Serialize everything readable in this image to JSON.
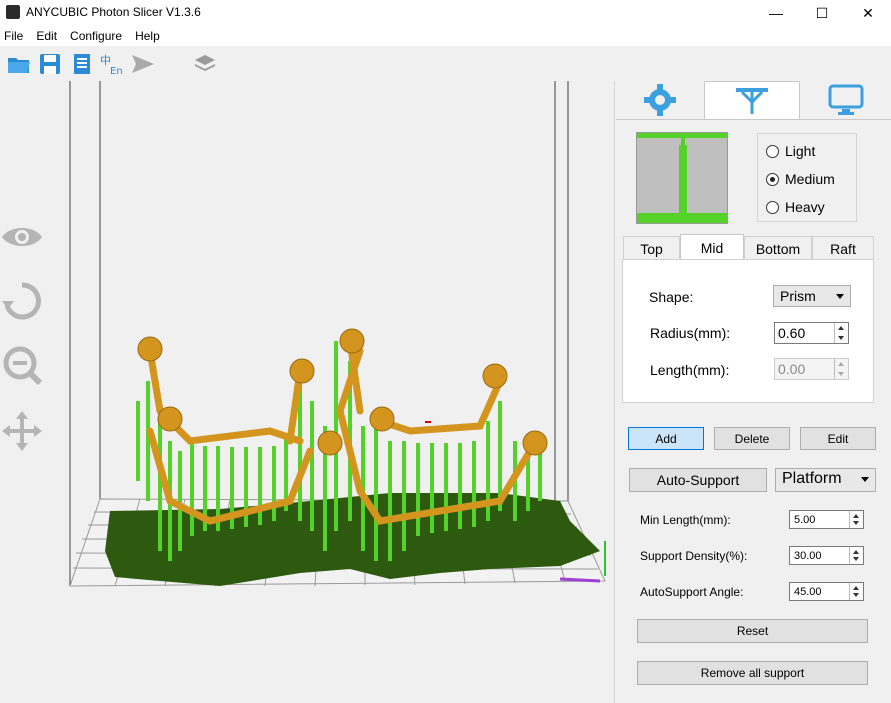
{
  "window": {
    "title": "ANYCUBIC Photon Slicer V1.3.6",
    "controls": {
      "minimize": "—",
      "maximize": "☐",
      "close": "✕"
    }
  },
  "menu": {
    "items": [
      "File",
      "Edit",
      "Configure",
      "Help"
    ]
  },
  "toolbar": {
    "icons": [
      "open-folder-icon",
      "save-icon",
      "document-icon",
      "language-icon",
      "send-icon",
      "layers-icon"
    ]
  },
  "viewport": {
    "side_icons": [
      "eye-icon",
      "rotate-icon",
      "zoom-icon",
      "move-icon"
    ]
  },
  "panel": {
    "tabs": [
      "settings-tab",
      "support-tab",
      "display-tab"
    ],
    "active_tab": "support-tab",
    "density": {
      "options": [
        "Light",
        "Medium",
        "Heavy"
      ],
      "selected": "Medium"
    },
    "sub_tabs": [
      "Top",
      "Mid",
      "Bottom",
      "Raft"
    ],
    "active_sub_tab": "Mid",
    "mid": {
      "shape_label": "Shape:",
      "shape_value": "Prism",
      "radius_label": "Radius(mm):",
      "radius_value": "0.60",
      "length_label": "Length(mm):",
      "length_value": "0.00"
    },
    "buttons": {
      "add": "Add",
      "delete": "Delete",
      "edit": "Edit"
    },
    "auto_support": "Auto-Support",
    "platform": "Platform",
    "fields": [
      {
        "label": "Min Length(mm):",
        "value": "5.00"
      },
      {
        "label": "Support Density(%):",
        "value": "30.00"
      },
      {
        "label": "AutoSupport Angle:",
        "value": "45.00"
      }
    ],
    "reset": "Reset",
    "remove_all": "Remove all support"
  },
  "colors": {
    "accent": "#3c9fe0",
    "support_green": "#55d22a",
    "raft_green": "#2d5a0e",
    "model_orange": "#d4951f"
  }
}
